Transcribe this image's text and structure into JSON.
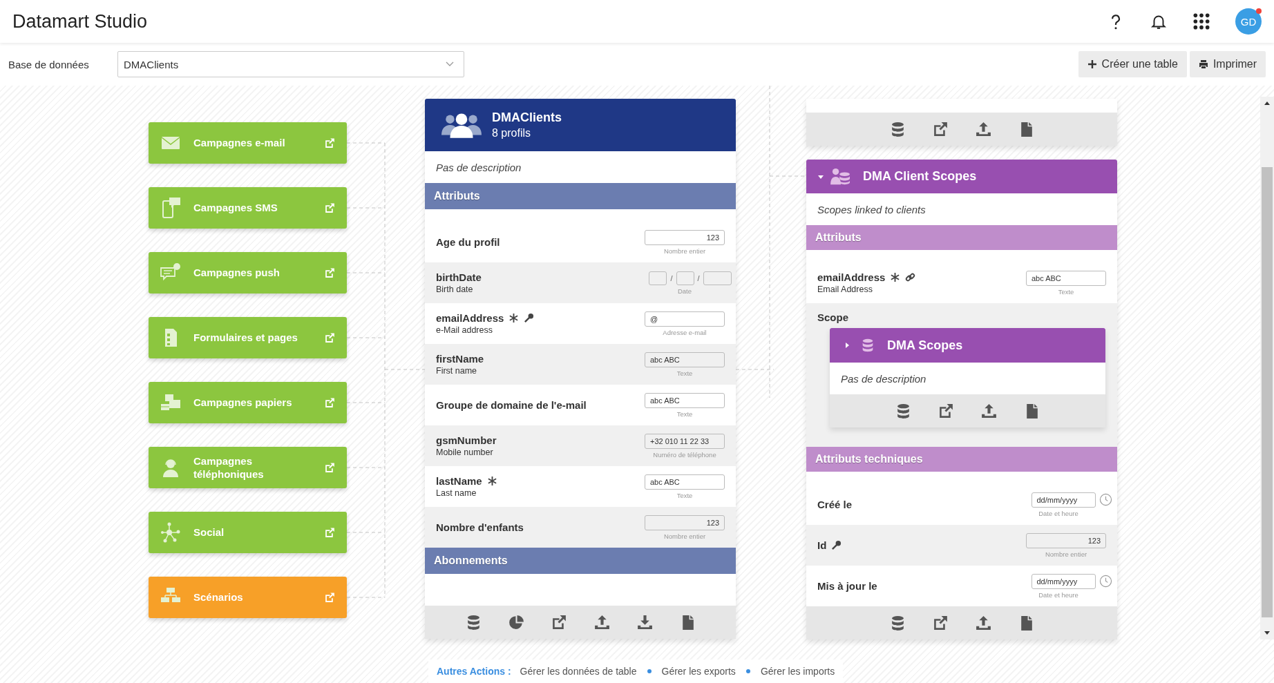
{
  "app": {
    "title": "Datamart Studio",
    "avatar": "GD",
    "notification": true
  },
  "database_bar": {
    "label": "Base de données",
    "value": "DMAClients",
    "buttons": [
      {
        "label": "Créer une table",
        "kind": "plus"
      },
      {
        "label": "Imprimer",
        "kind": "print"
      }
    ]
  },
  "channels": [
    {
      "label": "Campagnes e-mail",
      "kind": "email",
      "color": "#8cc63f"
    },
    {
      "label": "Campagnes SMS",
      "kind": "sms",
      "color": "#8cc63f"
    },
    {
      "label": "Campagnes push",
      "kind": "push",
      "color": "#8cc63f"
    },
    {
      "label": "Formulaires et pages",
      "kind": "form",
      "color": "#8cc63f"
    },
    {
      "label": "Campagnes papiers",
      "kind": "paper",
      "color": "#8cc63f"
    },
    {
      "label": "Campagnes téléphoniques",
      "kind": "phone",
      "color": "#8cc63f"
    },
    {
      "label": "Social",
      "kind": "social",
      "color": "#8cc63f"
    },
    {
      "label": "Scénarios",
      "kind": "scenario",
      "color": "#f7a028"
    }
  ],
  "main_table": {
    "title": "DMAClients",
    "subtitle": "8 profils",
    "description": "Pas de description",
    "sections": [
      {
        "title": "Attributs",
        "rows": [
          {
            "name": "Age du profil",
            "required": false,
            "key": false,
            "field": {
              "kind": "number",
              "placeholder": "123",
              "hint": "Nombre entier"
            }
          },
          {
            "name": "birthDate",
            "caption": "Birth date",
            "required": false,
            "key": false,
            "field": {
              "kind": "date",
              "separator": "/",
              "hint": "Date"
            }
          },
          {
            "name": "emailAddress",
            "caption": "e-Mail address",
            "required": true,
            "key": true,
            "field": {
              "kind": "text",
              "placeholder": "@",
              "hint": "Adresse e-mail"
            }
          },
          {
            "name": "firstName",
            "caption": "First name",
            "required": false,
            "key": false,
            "field": {
              "kind": "text",
              "placeholder": "abc ABC",
              "hint": "Texte"
            }
          },
          {
            "name": "Groupe de domaine de l'e-mail",
            "required": false,
            "key": false,
            "field": {
              "kind": "text",
              "placeholder": "abc ABC",
              "hint": "Texte"
            }
          },
          {
            "name": "gsmNumber",
            "caption": "Mobile number",
            "required": false,
            "key": false,
            "field": {
              "kind": "text",
              "placeholder": "+32 010 11 22 33",
              "hint": "Numéro de téléphone"
            }
          },
          {
            "name": "lastName",
            "caption": "Last name",
            "required": true,
            "key": false,
            "field": {
              "kind": "text",
              "placeholder": "abc ABC",
              "hint": "Texte"
            }
          },
          {
            "name": "Nombre d'enfants",
            "required": false,
            "key": false,
            "field": {
              "kind": "number",
              "placeholder": "123",
              "hint": "Nombre entier"
            }
          }
        ]
      },
      {
        "title": "Abonnements"
      }
    ],
    "toolbar": [
      {
        "kind": "database"
      },
      {
        "kind": "chart"
      },
      {
        "kind": "open"
      },
      {
        "kind": "upload"
      },
      {
        "kind": "download"
      },
      {
        "kind": "file"
      }
    ]
  },
  "previous_table": {
    "toolbar": [
      {
        "kind": "database"
      },
      {
        "kind": "open"
      },
      {
        "kind": "upload"
      },
      {
        "kind": "file"
      }
    ]
  },
  "linked_table": {
    "title": "DMA Client Scopes",
    "expanded": true,
    "description": "Scopes linked to clients",
    "sections": [
      {
        "title": "Attributs",
        "rows": [
          {
            "kind": "attribute",
            "name": "emailAddress",
            "caption": "Email Address",
            "required": true,
            "link": true,
            "field": {
              "kind": "text",
              "placeholder": "abc ABC",
              "hint": "Texte"
            }
          },
          {
            "kind": "relation",
            "name": "Scope",
            "table": {
              "title": "DMA Scopes",
              "expanded": false,
              "description": "Pas de description",
              "toolbar": [
                {
                  "kind": "database"
                },
                {
                  "kind": "open"
                },
                {
                  "kind": "upload"
                },
                {
                  "kind": "file"
                }
              ]
            }
          }
        ]
      },
      {
        "title": "Attributs techniques",
        "rows": [
          {
            "kind": "attribute",
            "name": "Créé le",
            "required": false,
            "key": false,
            "field": {
              "kind": "datetime",
              "placeholder": "dd/mm/yyyy",
              "hint": "Date et heure"
            }
          },
          {
            "kind": "attribute",
            "name": "Id",
            "required": false,
            "key": true,
            "field": {
              "kind": "number",
              "placeholder": "123",
              "hint": "Nombre entier"
            }
          },
          {
            "kind": "attribute",
            "name": "Mis à jour le",
            "required": false,
            "key": false,
            "field": {
              "kind": "datetime",
              "placeholder": "dd/mm/yyyy",
              "hint": "Date et heure"
            }
          }
        ]
      }
    ],
    "toolbar": [
      {
        "kind": "database"
      },
      {
        "kind": "open"
      },
      {
        "kind": "upload"
      },
      {
        "kind": "file"
      }
    ]
  },
  "footer": {
    "label": "Autres Actions :",
    "links": [
      "Gérer les données de table",
      "Gérer les exports",
      "Gérer les imports"
    ]
  }
}
